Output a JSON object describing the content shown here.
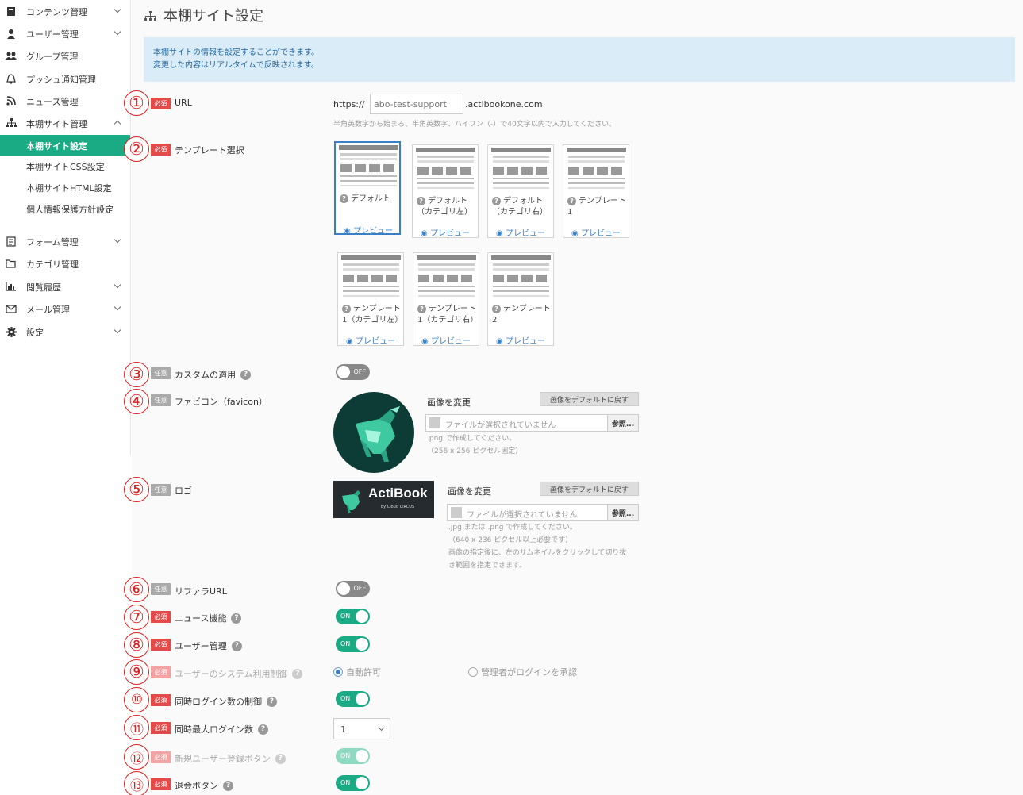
{
  "sidebar": {
    "items": [
      {
        "label": "コンテンツ管理",
        "icon": "book-icon"
      },
      {
        "label": "ユーザー管理",
        "icon": "user-icon"
      },
      {
        "label": "グループ管理",
        "icon": "group-icon"
      },
      {
        "label": "プッシュ通知管理",
        "icon": "bell-icon"
      },
      {
        "label": "ニュース管理",
        "icon": "rss-icon"
      },
      {
        "label": "本棚サイト管理",
        "icon": "sitemap-icon"
      },
      {
        "label": "フォーム管理",
        "icon": "form-icon"
      },
      {
        "label": "カテゴリ管理",
        "icon": "folder-icon"
      },
      {
        "label": "閲覧履歴",
        "icon": "chart-icon"
      },
      {
        "label": "メール管理",
        "icon": "mail-icon"
      },
      {
        "label": "設定",
        "icon": "gear-icon"
      }
    ],
    "subitems": [
      "本棚サイト設定",
      "本棚サイトCSS設定",
      "本棚サイトHTML設定",
      "個人情報保護方針設定"
    ]
  },
  "page": {
    "title": "本棚サイト設定",
    "info_line1": "本棚サイトの情報を設定することができます。",
    "info_line2": "変更した内容はリアルタイムで反映されます。"
  },
  "badges": {
    "required": "必須",
    "optional": "任意"
  },
  "numbers": [
    "①",
    "②",
    "③",
    "④",
    "⑤",
    "⑥",
    "⑦",
    "⑧",
    "⑨",
    "⑩",
    "⑪",
    "⑫",
    "⑬"
  ],
  "url": {
    "label": "URL",
    "prefix": "https://",
    "value": "abo-test-support",
    "suffix": ".actibookone.com",
    "hint": "半角英数字から始まる、半角英数字、ハイフン（-）で40文字以内で入力してください。"
  },
  "template": {
    "label": "テンプレート選択",
    "preview_label": "プレビュー",
    "items": [
      {
        "name": "デフォルト"
      },
      {
        "name": "デフォルト（カテゴリ左）"
      },
      {
        "name": "デフォルト（カテゴリ右）"
      },
      {
        "name": "テンプレート1"
      },
      {
        "name": "テンプレート1（カテゴリ左）"
      },
      {
        "name": "テンプレート1（カテゴリ右）"
      },
      {
        "name": "テンプレート2"
      }
    ]
  },
  "custom": {
    "label": "カスタムの適用",
    "toggle": "OFF"
  },
  "favicon": {
    "label": "ファビコン（favicon）",
    "change_label": "画像を変更",
    "reset_button": "画像をデフォルトに戻す",
    "file_placeholder": "ファイルが選択されていません",
    "browse_button": "参照...",
    "hint1": ".png で作成してください。",
    "hint2": "（256 x 256 ピクセル固定）"
  },
  "logo": {
    "label": "ロゴ",
    "brand_text": "ActiBook",
    "brand_sub": "by Cloud CIRCUS",
    "change_label": "画像を変更",
    "reset_button": "画像をデフォルトに戻す",
    "file_placeholder": "ファイルが選択されていません",
    "browse_button": "参照...",
    "hint1": ".jpg または .png で作成してください。",
    "hint2": "（640 x 236 ピクセル以上必要です）",
    "hint3": "画像の指定後に、左のサムネイルをクリックして切り抜",
    "hint4": "き範囲を指定できます。"
  },
  "referrer": {
    "label": "リファラURL",
    "toggle": "OFF"
  },
  "news": {
    "label": "ニュース機能",
    "toggle": "ON"
  },
  "user_mgmt": {
    "label": "ユーザー管理",
    "toggle": "ON"
  },
  "system_use": {
    "label": "ユーザーのシステム利用制御",
    "option1": "自動許可",
    "option2": "管理者がログインを承認"
  },
  "concurrent": {
    "label": "同時ログイン数の制御",
    "toggle": "ON"
  },
  "max_login": {
    "label": "同時最大ログイン数",
    "value": "1"
  },
  "new_user_btn": {
    "label": "新規ユーザー登録ボタン",
    "toggle": "ON"
  },
  "withdraw_btn": {
    "label": "退会ボタン",
    "toggle": "ON"
  }
}
